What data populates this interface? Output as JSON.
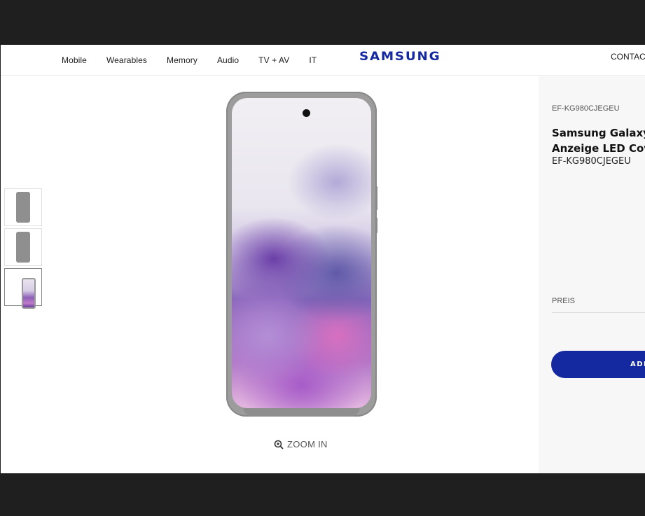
{
  "header": {
    "nav": [
      "Mobile",
      "Wearables",
      "Memory",
      "Audio",
      "TV + AV",
      "IT"
    ],
    "logo": "SAMSUNG",
    "contact": "CONTACT",
    "brand_color": "#1428a0"
  },
  "gallery": {
    "thumbnails": [
      {
        "name": "case-back-gray",
        "active": false
      },
      {
        "name": "case-back-gray-alt",
        "active": false
      },
      {
        "name": "case-front-screen",
        "active": true
      }
    ],
    "zoom_label": "ZOOM IN",
    "zoom_icon": "zoom-in-icon"
  },
  "product": {
    "model_small": "EF-KG980CJEGEU",
    "title_line1": "Samsung Galaxy S",
    "title_line2": "Anzeige LED Cove",
    "model_big": "EF-KG980CJEGEU",
    "price_label": "PREIS",
    "add_button": "ADD"
  }
}
